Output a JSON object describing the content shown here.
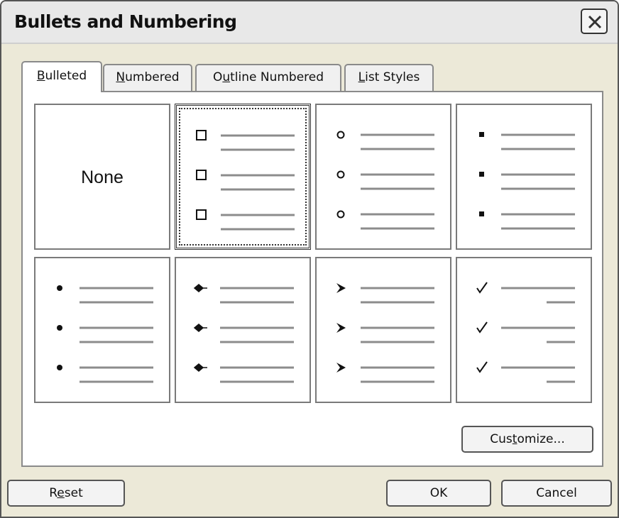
{
  "dialog": {
    "title": "Bullets and Numbering",
    "close_icon": "close-icon"
  },
  "tabs": [
    {
      "pre": "",
      "u": "B",
      "post": "ulleted",
      "active": true
    },
    {
      "pre": "",
      "u": "N",
      "post": "umbered",
      "active": false
    },
    {
      "pre": "O",
      "u": "u",
      "post": "tline Numbered",
      "active": false
    },
    {
      "pre": "",
      "u": "L",
      "post": "ist Styles",
      "active": false
    }
  ],
  "gallery": {
    "none_label": "None",
    "selected_index": 1,
    "options": [
      "none",
      "hollow-square",
      "hollow-circle",
      "small-square",
      "filled-circle",
      "arrow-diamond",
      "arrowhead",
      "check-mark"
    ]
  },
  "buttons": {
    "customize": {
      "pre": "Cus",
      "u": "t",
      "post": "omize..."
    },
    "reset": {
      "pre": "R",
      "u": "e",
      "post": "set"
    },
    "ok": {
      "pre": "OK",
      "u": "",
      "post": ""
    },
    "cancel": {
      "pre": "Cancel",
      "u": "",
      "post": ""
    }
  },
  "colors": {
    "line": "#8c8c8c",
    "bullet": "#111111",
    "accent": "#ece9d8"
  }
}
